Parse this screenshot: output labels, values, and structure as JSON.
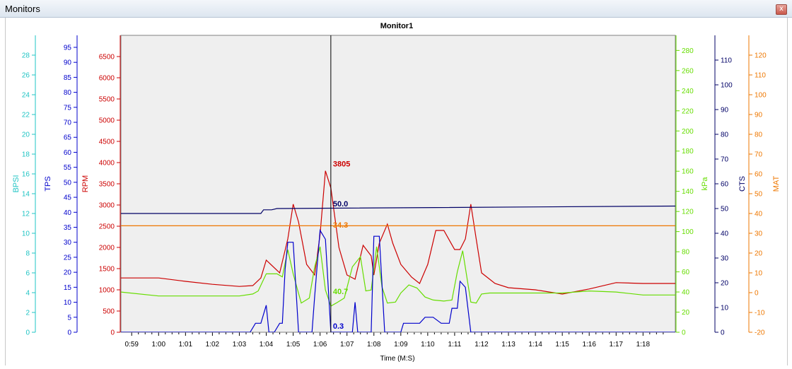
{
  "window": {
    "title": "Monitors",
    "close_glyph": "x"
  },
  "chart_data": {
    "type": "line",
    "title": "Monitor1",
    "xlabel": "Time (M:S)",
    "x_ticks": [
      "0:59",
      "1:00",
      "1:01",
      "1:02",
      "1:03",
      "1:04",
      "1:05",
      "1:06",
      "1:07",
      "1:08",
      "1:09",
      "1:10",
      "1:11",
      "1:12",
      "1:13",
      "1:14",
      "1:15",
      "1:16",
      "1:17",
      "1:18"
    ],
    "x_range_seconds": [
      58.6,
      1159.2
    ],
    "cursor": {
      "time": "1:06.4",
      "time_seconds": 66.4
    },
    "grid": false,
    "background": "#efefef",
    "axes": [
      {
        "id": "BPSI",
        "label": "BPSI",
        "color": "#1fc4c4",
        "side": "left",
        "min": 0,
        "max": 30,
        "ticks": [
          0,
          2,
          4,
          6,
          8,
          10,
          12,
          14,
          16,
          18,
          20,
          22,
          24,
          26,
          28
        ]
      },
      {
        "id": "TPS",
        "label": "TPS",
        "color": "#0000cc",
        "side": "left",
        "min": 0,
        "max": 99,
        "ticks": [
          0,
          5,
          10,
          15,
          20,
          25,
          30,
          35,
          40,
          45,
          50,
          55,
          60,
          65,
          70,
          75,
          80,
          85,
          90,
          95
        ]
      },
      {
        "id": "RPM",
        "label": "RPM",
        "color": "#cc0000",
        "side": "left",
        "min": 0,
        "max": 7000,
        "ticks": [
          0,
          500,
          1000,
          1500,
          2000,
          2500,
          3000,
          3500,
          4000,
          4500,
          5000,
          5500,
          6000,
          6500
        ]
      },
      {
        "id": "kPa",
        "label": "kPa",
        "color": "#66dd00",
        "side": "right",
        "min": 0,
        "max": 295,
        "ticks": [
          0,
          20,
          40,
          60,
          80,
          100,
          120,
          140,
          160,
          180,
          200,
          220,
          240,
          260,
          280
        ]
      },
      {
        "id": "CTS",
        "label": "CTS",
        "color": "#000066",
        "side": "right",
        "min": 0,
        "max": 120,
        "ticks": [
          0,
          10,
          20,
          30,
          40,
          50,
          60,
          70,
          80,
          90,
          100,
          110
        ]
      },
      {
        "id": "MAT",
        "label": "MAT",
        "color": "#ee7700",
        "side": "right",
        "min": -20,
        "max": 130,
        "ticks": [
          -20,
          -10,
          0,
          10,
          20,
          30,
          40,
          50,
          60,
          70,
          80,
          90,
          100,
          110,
          120
        ]
      }
    ],
    "series": [
      {
        "name": "RPM",
        "axis": "RPM",
        "color": "#cc0000",
        "cursor_value": "3805",
        "x": [
          58.6,
          60,
          61,
          62,
          63,
          63.5,
          63.8,
          64.0,
          64.5,
          64.8,
          65.0,
          65.2,
          65.5,
          65.8,
          66.0,
          66.2,
          66.4,
          66.7,
          67.0,
          67.3,
          67.6,
          67.9,
          68.0,
          68.2,
          68.5,
          68.7,
          69.0,
          69.4,
          69.7,
          70.0,
          70.3,
          70.6,
          71.0,
          71.2,
          71.4,
          71.6,
          71.8,
          72.0,
          72.5,
          73,
          74,
          75,
          76,
          77,
          78,
          79.2
        ],
        "y": [
          1280,
          1280,
          1200,
          1130,
          1080,
          1100,
          1280,
          1700,
          1400,
          2200,
          3020,
          2600,
          1600,
          1350,
          2300,
          3805,
          3400,
          2000,
          1350,
          1250,
          2050,
          1800,
          1350,
          2100,
          2550,
          2100,
          1600,
          1300,
          1150,
          1600,
          2400,
          2400,
          1950,
          1950,
          2200,
          3020,
          2200,
          1400,
          1150,
          1050,
          1000,
          900,
          1020,
          1170,
          1150,
          1150
        ]
      },
      {
        "name": "kPa",
        "axis": "kPa",
        "color": "#66dd00",
        "cursor_value": "40.7",
        "x": [
          58.6,
          60,
          61,
          62,
          63,
          63.5,
          63.7,
          64.0,
          64.4,
          64.6,
          64.8,
          65.0,
          65.3,
          65.6,
          65.8,
          66.0,
          66.2,
          66.4,
          66.6,
          66.9,
          67.2,
          67.5,
          67.7,
          67.9,
          68.1,
          68.3,
          68.5,
          68.8,
          69.0,
          69.3,
          69.6,
          69.9,
          70.2,
          70.6,
          70.9,
          71.1,
          71.3,
          71.6,
          71.8,
          72.0,
          72.3,
          73,
          74,
          75,
          76,
          77,
          78,
          79.2
        ],
        "y": [
          40,
          36,
          36,
          36,
          36,
          38,
          41,
          58,
          58,
          55,
          82,
          58,
          29,
          34,
          65,
          85,
          42,
          26,
          29,
          34,
          65,
          75,
          41,
          42,
          85,
          45,
          29,
          30,
          39,
          47,
          44,
          35,
          32,
          31,
          32,
          60,
          81,
          30,
          29,
          38,
          39,
          39,
          39,
          39,
          41,
          40,
          37,
          37
        ]
      },
      {
        "name": "TPS",
        "axis": "TPS",
        "color": "#0000cc",
        "cursor_value": "0.3",
        "x": [
          58.6,
          63.4,
          63.6,
          63.8,
          64.0,
          64.1,
          64.3,
          64.5,
          64.6,
          64.7,
          64.8,
          65.0,
          65.2,
          65.7,
          65.8,
          66.0,
          66.2,
          66.4,
          66.5,
          67.2,
          67.3,
          67.4,
          67.6,
          67.9,
          68.0,
          68.2,
          68.4,
          69.0,
          69.1,
          69.5,
          69.7,
          69.9,
          70.0,
          70.2,
          70.5,
          70.8,
          70.9,
          71.1,
          71.2,
          71.4,
          71.6,
          79.2
        ],
        "y": [
          0,
          0,
          3,
          3,
          9,
          0,
          0,
          3,
          3,
          21,
          30,
          30,
          0,
          0,
          12,
          34,
          31,
          0,
          0,
          0,
          10,
          0,
          0,
          0,
          32,
          32,
          0,
          0,
          3,
          3,
          3,
          5,
          5,
          5,
          3,
          3,
          8,
          8,
          17,
          15,
          0,
          0
        ]
      },
      {
        "name": "CTS",
        "axis": "CTS",
        "color": "#000066",
        "cursor_value": "50.0",
        "x": [
          58.6,
          63.8,
          63.9,
          64.2,
          64.4,
          79.2
        ],
        "y": [
          48,
          48,
          49.5,
          49.5,
          50,
          51
        ]
      },
      {
        "name": "MAT",
        "axis": "MAT",
        "color": "#ee7700",
        "cursor_value": "34.3",
        "x": [
          58.6,
          79.2
        ],
        "y": [
          33.8,
          33.8
        ]
      }
    ]
  }
}
